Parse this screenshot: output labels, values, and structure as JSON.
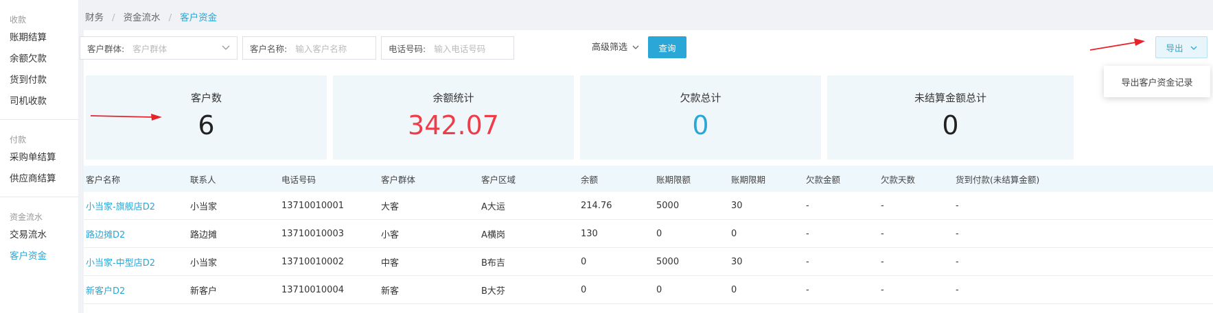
{
  "sidebar": {
    "groups": [
      {
        "title": "收款",
        "items": [
          "账期结算",
          "余额欠款",
          "货到付款",
          "司机收款"
        ]
      },
      {
        "title": "付款",
        "items": [
          "采购单结算",
          "供应商结算"
        ]
      },
      {
        "title": "资金流水",
        "items": [
          "交易流水",
          "客户资金"
        ]
      }
    ]
  },
  "breadcrumb": [
    "财务",
    "资金流水",
    "客户资金"
  ],
  "filters": {
    "group_label": "客户群体:",
    "group_placeholder": "客户群体",
    "name_label": "客户名称:",
    "name_placeholder": "输入客户名称",
    "phone_label": "电话号码:",
    "phone_placeholder": "输入电话号码",
    "advanced": "高级筛选",
    "query_button": "查询",
    "export_button": "导出"
  },
  "export_menu": {
    "item": "导出客户资金记录"
  },
  "stats": [
    {
      "label": "客户数",
      "value": "6",
      "color": "#222222"
    },
    {
      "label": "余额统计",
      "value": "342.07",
      "color": "#f03c49"
    },
    {
      "label": "欠款总计",
      "value": "0",
      "color": "#2aa7d6"
    },
    {
      "label": "未结算金额总计",
      "value": "0",
      "color": "#222222"
    }
  ],
  "table": {
    "headers": [
      "客户名称",
      "联系人",
      "电话号码",
      "客户群体",
      "客户区域",
      "余额",
      "账期限额",
      "账期限期",
      "欠款金额",
      "欠款天数",
      "货到付款(未结算金额)"
    ],
    "rows": [
      [
        "小当家-旗舰店D2",
        "小当家",
        "13710010001",
        "大客",
        "A大运",
        "214.76",
        "5000",
        "30",
        "-",
        "-",
        "-"
      ],
      [
        "路边摊D2",
        "路边摊",
        "13710010003",
        "小客",
        "A横岗",
        "130",
        "0",
        "0",
        "-",
        "-",
        "-"
      ],
      [
        "小当家-中型店D2",
        "小当家",
        "13710010002",
        "中客",
        "B布吉",
        "0",
        "5000",
        "30",
        "-",
        "-",
        "-"
      ],
      [
        "新客户D2",
        "新客户",
        "13710010004",
        "新客",
        "B大芬",
        "0",
        "0",
        "0",
        "-",
        "-",
        "-"
      ]
    ]
  },
  "colors": {
    "accent": "#2aa7d6",
    "danger": "#f03c49",
    "annotation_arrow": "#e8222a"
  }
}
